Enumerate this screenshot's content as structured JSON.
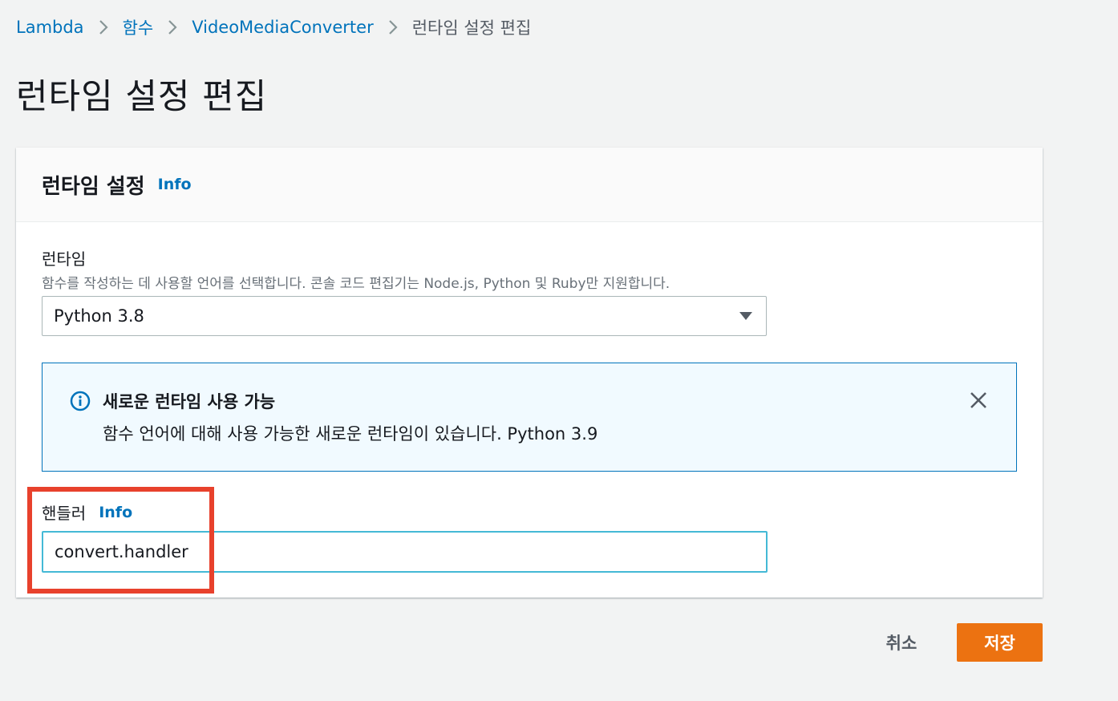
{
  "breadcrumb": {
    "items": [
      "Lambda",
      "함수",
      "VideoMediaConverter"
    ],
    "current": "런타임 설정 편집"
  },
  "page": {
    "title": "런타임 설정 편집"
  },
  "panel": {
    "title": "런타임 설정",
    "info_label": "Info",
    "runtime": {
      "label": "런타임",
      "description": "함수를 작성하는 데 사용할 언어를 선택합니다. 콘솔 코드 편집기는 Node.js, Python 및 Ruby만 지원합니다.",
      "selected": "Python 3.8"
    },
    "alert": {
      "title": "새로운 런타임 사용 가능",
      "message": "함수 언어에 대해 사용 가능한 새로운 런타임이 있습니다. Python 3.9"
    },
    "handler": {
      "label": "핸들러",
      "info_label": "Info",
      "value": "convert.handler"
    }
  },
  "actions": {
    "cancel_label": "취소",
    "save_label": "저장"
  },
  "colors": {
    "link": "#0073bb",
    "primary": "#ec7211",
    "alert_border": "#0073bb",
    "alert_bg": "#f1faff",
    "focus_border": "#44b9d6",
    "highlight": "#e8412c"
  },
  "icons": {
    "breadcrumb_separator": "chevron-right-icon",
    "dropdown": "caret-down-icon",
    "alert": "info-circle-icon",
    "close": "close-icon"
  }
}
